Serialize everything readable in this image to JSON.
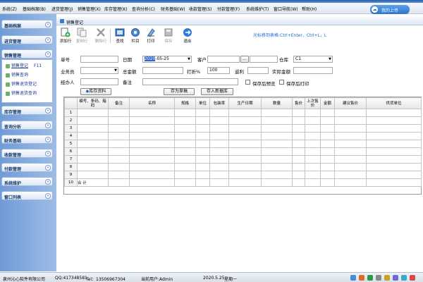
{
  "menu": [
    "系统(Z)",
    "基础档案(B)",
    "进货管理(J)",
    "销售管理(X)",
    "库存管理(K)",
    "查询分析(C)",
    "财务基础(W)",
    "收款管理(S)",
    "付款管理(F)",
    "系统维护(T)",
    "窗口导航(W)",
    "帮助(H)"
  ],
  "login_button": "我的上传",
  "sidebar": {
    "groups": [
      "基础档案",
      "进货管理",
      "销售管理",
      "库存管理",
      "查询分析",
      "财务基础",
      "收款管理",
      "付款管理",
      "系统维护",
      "窗口列表"
    ],
    "sales_items": [
      "销售登记",
      "销售查询",
      "销售退货登记",
      "销售退货查询"
    ],
    "active_shortcut": "F11"
  },
  "window": {
    "title": "销售登记"
  },
  "toolbar": {
    "buttons": [
      "添加行",
      "复制行",
      "删除行",
      "查找",
      "栏目",
      "打印",
      "保存",
      "退出"
    ],
    "hint": "光标移到表格:Ctrl+Enter，Ctrl+L，L"
  },
  "form": {
    "labels": {
      "order_no": "单号",
      "date": "日期",
      "customer": "客户",
      "warehouse": "仓库",
      "salesman": "业务员",
      "total_amount": "总金额",
      "discount": "打折%",
      "rebate": "返利",
      "actual_amount": "实际金额",
      "handler": "经办人",
      "remark": "备注"
    },
    "values": {
      "date_year": "2020",
      "date_rest": "-05-25",
      "warehouse": "C1",
      "discount": "100",
      "customer_btn": "..."
    },
    "buttons": {
      "stock_info": "库存资料",
      "save_draft": "存为草稿",
      "save_new": "存入新据库"
    },
    "checkboxes": [
      "保存后预览",
      "保存后打印"
    ]
  },
  "grid": {
    "columns": [
      "",
      "编号、条码、箱码",
      "备注",
      "名称",
      "规格",
      "单位",
      "包装率",
      "生产日期",
      "数量",
      "售价",
      "上次售价",
      "金额",
      "建议售价",
      "供货单位"
    ],
    "rows": [
      "1",
      "2",
      "3",
      "4",
      "5",
      "6",
      "7",
      "8",
      "9",
      "10"
    ],
    "total_label": "合 计"
  },
  "statusbar": {
    "company": "泉州沁心软件有限公司",
    "qq": "QQ:417348581",
    "tel": "Tel：13506967304",
    "user": "当前用户:Admin",
    "date": "2020.5.25",
    "weekday": "星期一"
  },
  "colors": {
    "accent": "#3c7cc9",
    "hint": "#1a6ad0",
    "sidebar": "#7ea6dc"
  }
}
